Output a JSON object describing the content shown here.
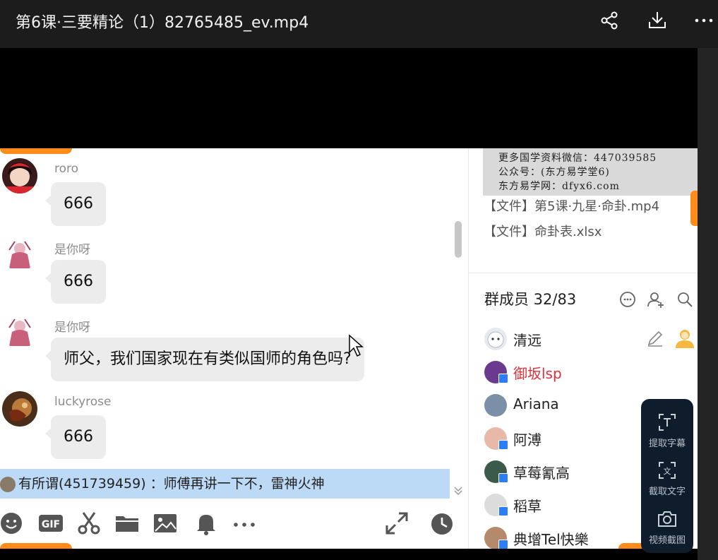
{
  "window": {
    "title": "第6课·三要精论（1）82765485_ev.mp4",
    "actions": [
      "share-icon",
      "download-icon",
      "more-icon"
    ]
  },
  "chat": {
    "messages": [
      {
        "nick": "roro",
        "text": "666"
      },
      {
        "nick": "是你呀",
        "text": "666"
      },
      {
        "nick": "是你呀",
        "text": "师父，我们国家现在有类似国师的角色吗?"
      },
      {
        "nick": "luckyrose",
        "text": "666"
      }
    ],
    "notice": "有所谓(451739459) ：师傅再讲一下不，雷神火神",
    "toolbar": [
      "emoji-icon",
      "gif-icon",
      "scissors-icon",
      "folder-icon",
      "image-icon",
      "bell-icon",
      "more-icon",
      "expand-icon",
      "history-icon"
    ]
  },
  "side": {
    "watermark": [
      "更多国学资料微信：447039585",
      "公众号：(东方易学堂6)",
      "东方易学网：dfyx6.com"
    ],
    "files": [
      "【文件】第5课·九星·命卦.mp4",
      "【文件】命卦表.xlsx"
    ],
    "members_title": "群成员 32/83",
    "members": [
      {
        "name": "清远",
        "highlight": false
      },
      {
        "name": "御坂lsp",
        "highlight": true
      },
      {
        "name": "Ariana",
        "highlight": false
      },
      {
        "name": "阿溥",
        "highlight": false
      },
      {
        "name": "草莓氰高",
        "highlight": false
      },
      {
        "name": "稻草",
        "highlight": false
      },
      {
        "name": "典增Tel快樂",
        "highlight": false
      }
    ]
  },
  "float_tools": [
    {
      "label": "提取字幕"
    },
    {
      "label": "截取文字"
    },
    {
      "label": "视频截图"
    }
  ],
  "colors": {
    "accent": "#ff8c1a",
    "notice_bg": "#bcd9f5",
    "member_highlight": "#e0313a",
    "float_bg": "#0f1c2b"
  }
}
